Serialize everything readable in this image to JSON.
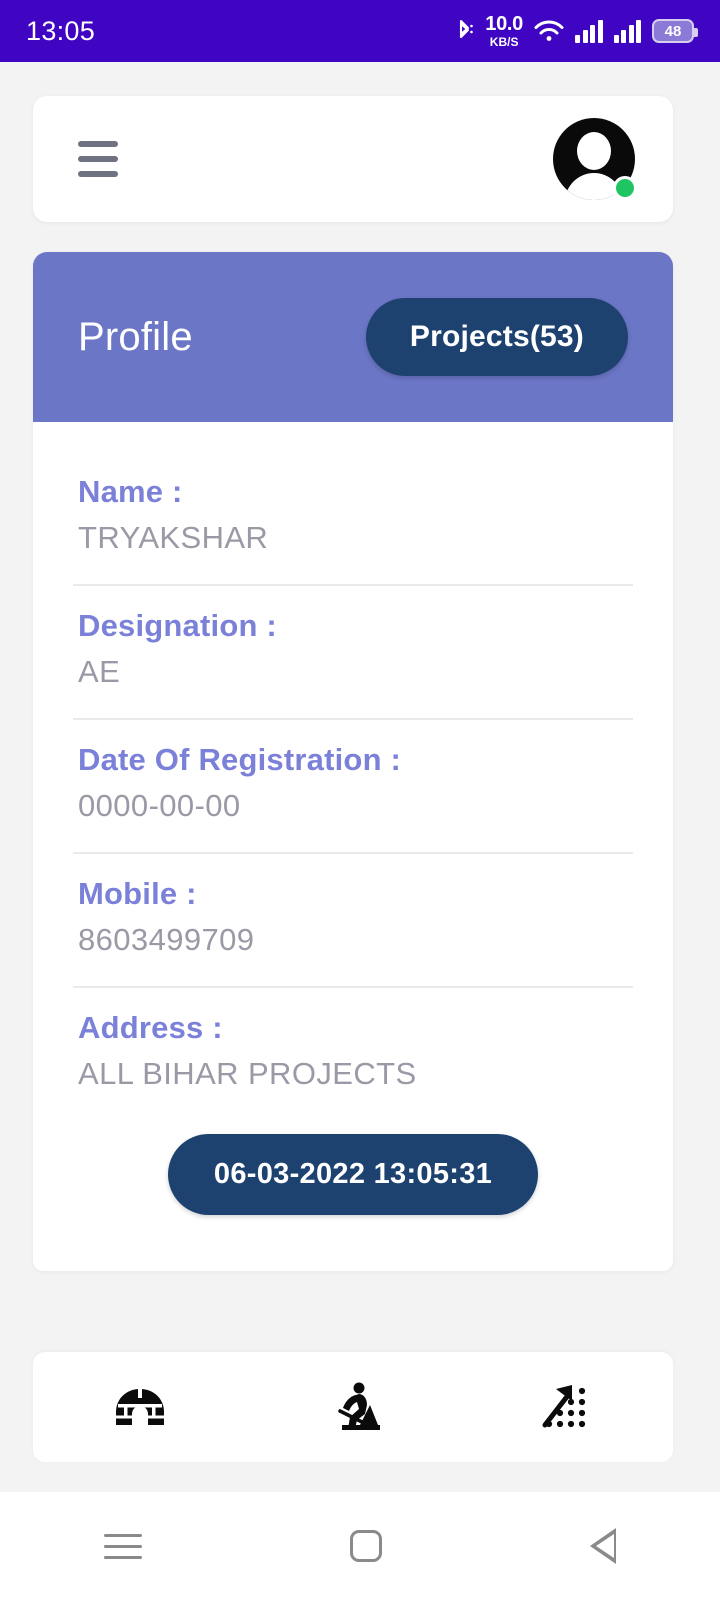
{
  "status_bar": {
    "time": "13:05",
    "bluetooth_icon": "bluetooth-icon",
    "network_speed_value": "10.0",
    "network_speed_unit": "KB/S",
    "wifi_icon": "wifi-icon",
    "signal_icon_1": "cellular-signal-icon",
    "signal_icon_2": "cellular-signal-icon",
    "battery_level": "48",
    "background_color": "#3f05c2"
  },
  "app_bar": {
    "menu_icon": "hamburger-menu-icon",
    "avatar_icon": "user-avatar-icon",
    "online_status": "online",
    "online_color": "#1ec562"
  },
  "profile_card": {
    "header": {
      "title": "Profile",
      "projects_button_label": "Projects(53)",
      "projects_count": "53",
      "band_color": "#6b76c6",
      "button_color": "#1d4270"
    },
    "fields": [
      {
        "label": "Name :",
        "value": "TRYAKSHAR"
      },
      {
        "label": "Designation :",
        "value": "AE"
      },
      {
        "label": "Date Of Registration :",
        "value": "0000-00-00"
      },
      {
        "label": "Mobile :",
        "value": "8603499709"
      },
      {
        "label": "Address :",
        "value": "ALL BIHAR PROJECTS"
      }
    ],
    "timestamp_button_label": "06-03-2022 13:05:31",
    "label_color": "#7b80d8",
    "value_color": "#9a9aa7"
  },
  "bottom_nav": {
    "items": [
      {
        "icon": "igloo-icon",
        "name": "nav-igloo"
      },
      {
        "icon": "construction-worker-icon",
        "name": "nav-construction"
      },
      {
        "icon": "growth-arrow-dots-icon",
        "name": "nav-growth"
      }
    ]
  },
  "system_nav": {
    "recents_icon": "recents-icon",
    "home_icon": "home-icon",
    "back_icon": "back-icon"
  }
}
